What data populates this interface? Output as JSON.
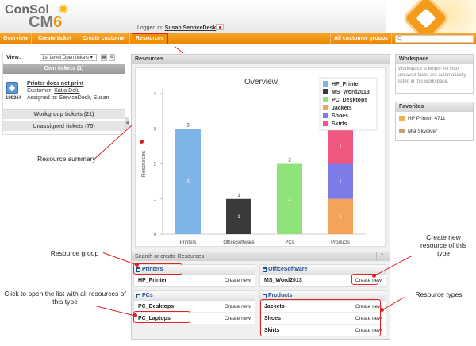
{
  "app": {
    "logo_text": "ConSol",
    "logo_cm": "CM",
    "logo_version": "6",
    "login_label": "Logged in:",
    "user": "Susan ServiceDesk"
  },
  "nav": {
    "items": [
      "Overview",
      "Create ticket",
      "Create customer",
      "Resources"
    ],
    "customer_groups": "All customer groups",
    "search_placeholder": "Q"
  },
  "left": {
    "view_label": "View:",
    "view_value": "1st Level Open tickets",
    "own_tickets": "Own tickets (1)",
    "ticket": {
      "number": "100364",
      "title": "Printer does not print",
      "customer_label": "Customer:",
      "customer": "Katja Dolu",
      "assigned": "Assigned to: ServiceDesk, Susan"
    },
    "workgroup": "Workgroup tickets (21)",
    "unassigned": "Unassigned tickets (75)"
  },
  "main": {
    "resources_title": "Resources",
    "search_create_title": "Search or create Resources",
    "create_new": "Create new",
    "groups": [
      {
        "name": "Printers",
        "items": [
          "HP_Printer"
        ]
      },
      {
        "name": "OfficeSoftware",
        "items": [
          "MS_Word2013"
        ]
      },
      {
        "name": "PCs",
        "items": [
          "PC_Desktops",
          "PC_Laptops"
        ]
      },
      {
        "name": "Products",
        "items": [
          "Jackets",
          "Shoes",
          "Skirts"
        ]
      }
    ]
  },
  "chart_data": {
    "type": "bar",
    "title": "Overview",
    "ylabel": "Resources",
    "categories": [
      "Printers",
      "OfficeSoftware",
      "PCs",
      "Products"
    ],
    "ylim": [
      0,
      4
    ],
    "yticks": [
      0,
      1,
      2,
      3,
      4
    ],
    "stacked": true,
    "series": [
      {
        "name": "HP_Printer",
        "color": "#7eb5e8",
        "values": [
          3,
          0,
          0,
          0
        ]
      },
      {
        "name": "MS_Word2013",
        "color": "#3a3a3a",
        "values": [
          0,
          1,
          0,
          0
        ]
      },
      {
        "name": "PC_Desktops",
        "color": "#90e37a",
        "values": [
          0,
          0,
          2,
          0
        ]
      },
      {
        "name": "Jackets",
        "color": "#f4a35a",
        "values": [
          0,
          0,
          0,
          1
        ]
      },
      {
        "name": "Shoes",
        "color": "#7d7be8",
        "values": [
          0,
          0,
          0,
          1
        ]
      },
      {
        "name": "Skirts",
        "color": "#f0577e",
        "values": [
          0,
          0,
          0,
          1
        ]
      }
    ],
    "totals": [
      3,
      1,
      2,
      3
    ],
    "legend_position": "top-right"
  },
  "workspace": {
    "title": "Workspace",
    "text": "Workspace is empty. All your unsaved tasks are automatically listed in this workspace."
  },
  "favorites": {
    "title": "Favorites",
    "items": [
      "HP Printer: 4711",
      "Mia Skydiver"
    ]
  },
  "annotations": {
    "summary": "Resource summary",
    "group": "Resource group",
    "open_list": "Click to open the list with all resources of this type",
    "create_new": "Create new resource of this type",
    "types": "Resource types"
  }
}
